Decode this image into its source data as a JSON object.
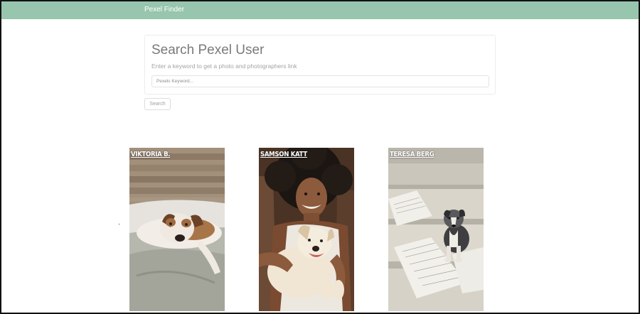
{
  "navbar": {
    "brand": "Pexel Finder"
  },
  "search": {
    "title": "Search Pexel User",
    "subtitle": "Enter a keyword to get a photo and photographers link",
    "placeholder": "Pexels Keyword...",
    "value": "",
    "button_label": "Search"
  },
  "results": [
    {
      "photographer": "VIKTORIA B.",
      "subject": "dog lying on bed"
    },
    {
      "photographer": "SAMSON KATT",
      "subject": "woman hugging dog"
    },
    {
      "photographer": "TERESA BERG",
      "subject": "puppy on stairs with sheet music"
    }
  ],
  "colors": {
    "navbar": "#97c5ad",
    "title": "#7a7a7a"
  }
}
